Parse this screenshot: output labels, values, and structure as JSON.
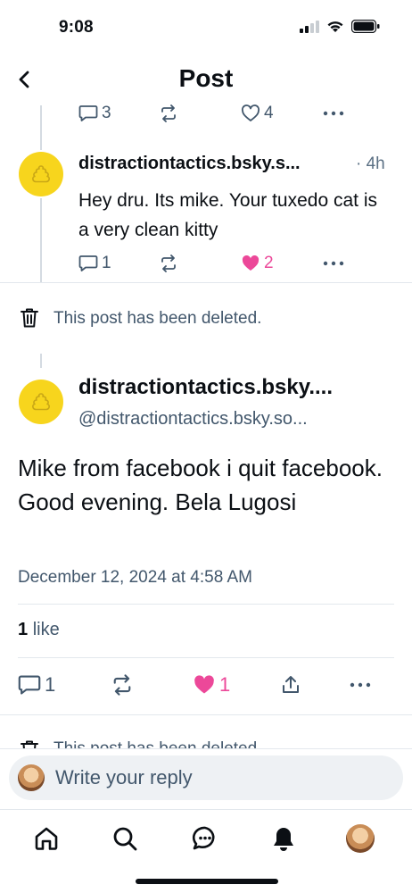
{
  "status_bar": {
    "time": "9:08"
  },
  "header": {
    "title": "Post"
  },
  "parent_post": {
    "reply_count": "3",
    "like_count": "4"
  },
  "reply_post": {
    "handle_display": "distractiontactics.bsky.s...",
    "time": "· 4h",
    "text": "Hey dru. Its mike. Your tuxedo cat is a very clean kitty",
    "reply_count": "1",
    "like_count": "2"
  },
  "deleted_notice": {
    "text": "This post has been deleted."
  },
  "main_post": {
    "display_name": "distractiontactics.bsky....",
    "handle": "@distractiontactics.bsky.so...",
    "text": "Mike  from facebook i quit facebook. Good evening. Bela Lugosi",
    "date": "December 12, 2024 at 4:58 AM",
    "likes_count": "1",
    "likes_label": "like",
    "reply_count": "1",
    "like_count": "1"
  },
  "next_deleted_notice": {
    "text": "This post has been deleted."
  },
  "composer": {
    "placeholder": "Write your reply"
  },
  "tabbar": {
    "items": [
      "home-icon",
      "search-icon",
      "chat-icon",
      "notifications-icon",
      "profile-avatar"
    ]
  },
  "colors": {
    "accent_like": "#ec4899",
    "muted": "#42576c",
    "avatar_yellow": "#f7d51d"
  }
}
